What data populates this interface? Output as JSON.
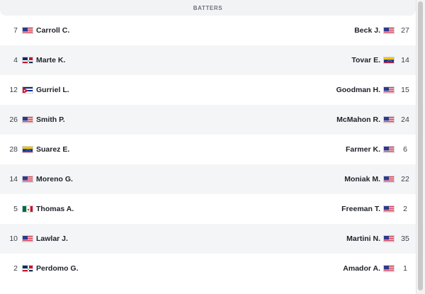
{
  "header": {
    "title": "BATTERS"
  },
  "rows": [
    {
      "left": {
        "num": "7",
        "flag": "us-flag-icon",
        "name": "Carroll C."
      },
      "right": {
        "name": "Beck J.",
        "flag": "us-flag-icon",
        "num": "27"
      }
    },
    {
      "left": {
        "num": "4",
        "flag": "do-flag-icon",
        "name": "Marte K."
      },
      "right": {
        "name": "Tovar E.",
        "flag": "ve-flag-icon",
        "num": "14"
      }
    },
    {
      "left": {
        "num": "12",
        "flag": "cu-flag-icon",
        "name": "Gurriel L."
      },
      "right": {
        "name": "Goodman H.",
        "flag": "us-flag-icon",
        "num": "15"
      }
    },
    {
      "left": {
        "num": "26",
        "flag": "us-flag-icon",
        "name": "Smith P."
      },
      "right": {
        "name": "McMahon R.",
        "flag": "us-flag-icon",
        "num": "24"
      }
    },
    {
      "left": {
        "num": "28",
        "flag": "ve-flag-icon",
        "name": "Suarez E."
      },
      "right": {
        "name": "Farmer K.",
        "flag": "us-flag-icon",
        "num": "6"
      }
    },
    {
      "left": {
        "num": "14",
        "flag": "us-flag-icon",
        "name": "Moreno G."
      },
      "right": {
        "name": "Moniak M.",
        "flag": "us-flag-icon",
        "num": "22"
      }
    },
    {
      "left": {
        "num": "5",
        "flag": "mx-flag-icon",
        "name": "Thomas A."
      },
      "right": {
        "name": "Freeman T.",
        "flag": "us-flag-icon",
        "num": "2"
      }
    },
    {
      "left": {
        "num": "10",
        "flag": "us-flag-icon",
        "name": "Lawlar J."
      },
      "right": {
        "name": "Martini N.",
        "flag": "us-flag-icon",
        "num": "35"
      }
    },
    {
      "left": {
        "num": "2",
        "flag": "do-flag-icon",
        "name": "Perdomo G."
      },
      "right": {
        "name": "Amador A.",
        "flag": "us-flag-icon",
        "num": "1"
      }
    }
  ]
}
